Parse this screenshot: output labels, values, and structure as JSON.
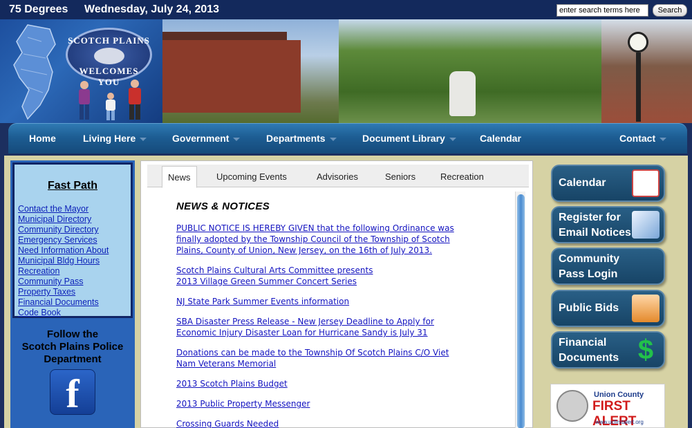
{
  "topbar": {
    "temperature": "75  Degrees",
    "date": "Wednesday, July 24, 2013",
    "search_placeholder": "enter search terms here",
    "search_button": "Search"
  },
  "banner": {
    "seal_top": "SCOTCH PLAINS",
    "seal_bottom": "WELCOMES YOU"
  },
  "nav": [
    {
      "label": "Home",
      "has_menu": false
    },
    {
      "label": "Living Here",
      "has_menu": true
    },
    {
      "label": "Government",
      "has_menu": true
    },
    {
      "label": "Departments",
      "has_menu": true
    },
    {
      "label": "Document Library",
      "has_menu": true
    },
    {
      "label": "Calendar",
      "has_menu": false
    },
    {
      "label": "Contact",
      "has_menu": true
    }
  ],
  "fast_path": {
    "title": "Fast Path",
    "links": [
      "Contact the Mayor",
      "Municipal Directory",
      "Community Directory",
      "Emergency Services",
      "Need Information About",
      "Municipal Bldg Hours",
      "Recreation",
      "Community Pass",
      "Property Taxes",
      "Financial Documents",
      "Code Book"
    ]
  },
  "follow": {
    "line1": "Follow the",
    "line2": "Scotch Plains Police",
    "line3": "Department",
    "icon_glyph": "f"
  },
  "tabs": [
    "News",
    "Upcoming Events",
    "Advisories",
    "Seniors",
    "Recreation"
  ],
  "active_tab": "News",
  "news": {
    "heading": "NEWS & NOTICES",
    "items": [
      [
        "PUBLIC NOTICE IS HEREBY GIVEN that the following Ordinance was",
        "finally adopted by the Township Council of the Township of Scotch",
        "Plains, County of Union, New Jersey, on the 16th of July 2013."
      ],
      [
        "Scotch Plains Cultural Arts Committee presents",
        "2013 Village Green Summer Concert Series"
      ],
      [
        "NJ State Park Summer Events information"
      ],
      [
        "SBA Disaster Press Release - New Jersey Deadline to Apply for",
        "Economic Injury Disaster Loan for Hurricane Sandy is July 31"
      ],
      [
        "Donations can be made to the Township Of Scotch Plains C/O Viet",
        "Nam Veterans Memorial"
      ],
      [
        "2013 Scotch Plains Budget"
      ],
      [
        "2013 Public Property Messenger"
      ],
      [
        "Crossing Guards Needed"
      ]
    ]
  },
  "quick_buttons": [
    {
      "line1": "Calendar",
      "line2": "",
      "icon": "calendar-icon"
    },
    {
      "line1": "Register for",
      "line2": "Email Notices",
      "icon": "envelope-icon"
    },
    {
      "line1": "Community",
      "line2": "Pass Login",
      "icon": ""
    },
    {
      "line1": "Public Bids",
      "line2": "",
      "icon": "auctioneer-icon"
    },
    {
      "line1": "Financial",
      "line2": "Documents",
      "icon": "dollar-icon"
    }
  ],
  "dollar_glyph": "$",
  "ad": {
    "title": "Union County",
    "subtitle": "FIRST ALERT",
    "url": "www.ucfirstalert.org"
  },
  "colors": {
    "topbar": "#13295c",
    "nav": "#1d5d93",
    "main_bg": "#d6d2a4",
    "link": "#1313c0",
    "fastpath_bg": "#a9d3ee"
  }
}
